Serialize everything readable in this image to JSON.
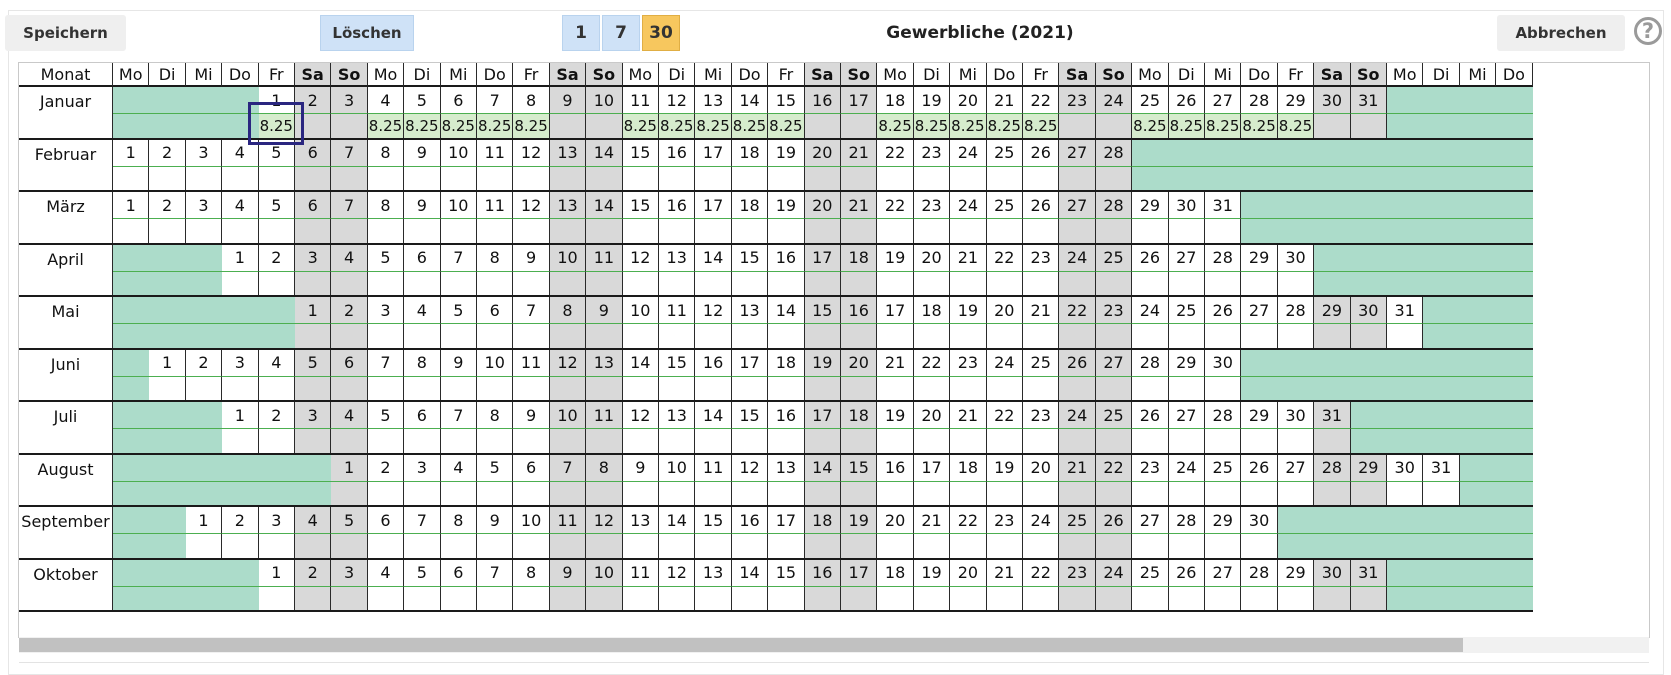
{
  "toolbar": {
    "save_label": "Speichern",
    "delete_label": "Löschen",
    "zoom_options": [
      "1",
      "7",
      "30"
    ],
    "zoom_active": "30",
    "title": "Gewerbliche (2021)",
    "cancel_label": "Abbrechen",
    "help_glyph": "?"
  },
  "calendar": {
    "month_header": "Monat",
    "weekday_header": [
      "Mo",
      "Di",
      "Mi",
      "Do",
      "Fr",
      "Sa",
      "So",
      "Mo",
      "Di",
      "Mi",
      "Do",
      "Fr",
      "Sa",
      "So",
      "Mo",
      "Di",
      "Mi",
      "Do",
      "Fr",
      "Sa",
      "So",
      "Mo",
      "Di",
      "Mi",
      "Do",
      "Fr",
      "Sa",
      "So",
      "Mo",
      "Di",
      "Mi",
      "Do",
      "Fr",
      "Sa",
      "So",
      "Mo",
      "Di",
      "Mi",
      "Do"
    ],
    "weekend_columns": [
      5,
      6,
      12,
      13,
      19,
      20,
      26,
      27,
      33,
      34
    ],
    "selected": {
      "month": "Januar",
      "day": 1
    },
    "months": [
      {
        "name": "Januar",
        "offset": 4,
        "days": 31,
        "values": {
          "1": "8.25",
          "4": "8.25",
          "5": "8.25",
          "6": "8.25",
          "7": "8.25",
          "8": "8.25",
          "11": "8.25",
          "12": "8.25",
          "13": "8.25",
          "14": "8.25",
          "15": "8.25",
          "18": "8.25",
          "19": "8.25",
          "20": "8.25",
          "21": "8.25",
          "22": "8.25",
          "25": "8.25",
          "26": "8.25",
          "27": "8.25",
          "28": "8.25",
          "29": "8.25"
        }
      },
      {
        "name": "Februar",
        "offset": 0,
        "days": 28,
        "values": {}
      },
      {
        "name": "März",
        "offset": 0,
        "days": 31,
        "values": {}
      },
      {
        "name": "April",
        "offset": 3,
        "days": 30,
        "values": {}
      },
      {
        "name": "Mai",
        "offset": 5,
        "days": 31,
        "values": {}
      },
      {
        "name": "Juni",
        "offset": 1,
        "days": 30,
        "values": {}
      },
      {
        "name": "Juli",
        "offset": 3,
        "days": 31,
        "values": {}
      },
      {
        "name": "August",
        "offset": 6,
        "days": 31,
        "values": {}
      },
      {
        "name": "September",
        "offset": 2,
        "days": 30,
        "values": {}
      },
      {
        "name": "Oktober",
        "offset": 4,
        "days": 31,
        "values": {}
      }
    ]
  }
}
